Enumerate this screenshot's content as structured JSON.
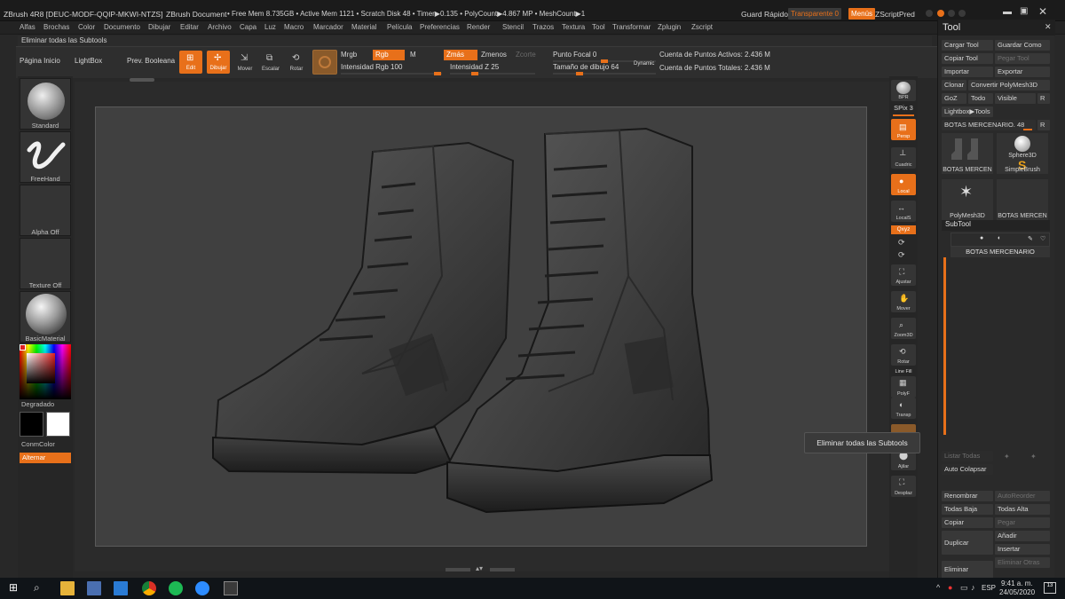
{
  "title": {
    "app": "ZBrush 4R8 [DEUC-MODF-QQIP-MKWI-NTZS]",
    "doc": "ZBrush Document",
    "stats": "• Free Mem 8.735GB • Active Mem 1121 • Scratch Disk 48 • Timer▶0.135 • PolyCount▶4.867 MP • MeshCount▶1",
    "quicksave": "Guard Rápido",
    "transparent": "Transparente 0",
    "menus": "Menús",
    "zscript": "ZScriptPred"
  },
  "menubar": [
    "Alfas",
    "Brochas",
    "Color",
    "Documento",
    "Dibujar",
    "Editar",
    "Archivo",
    "Capa",
    "Luz",
    "Macro",
    "Marcador",
    "Material",
    "Película",
    "Preferencias",
    "Render",
    "Stencil",
    "Trazos",
    "Textura",
    "Tool",
    "Transformar",
    "Zplugin",
    "Zscript"
  ],
  "notebar": "Eliminar todas las Subtools",
  "shelf": {
    "home": "Página Inicio",
    "lightbox": "LightBox",
    "preview": "Prev. Booleana",
    "edit": "Edit",
    "draw": "Dibujar",
    "move": "Mover",
    "scale": "Escalar",
    "rotate": "Rotar",
    "mrgb": "Mrgb",
    "rgb": "Rgb",
    "m": "M",
    "rgb_intensity": "Intensidad Rgb 100",
    "zadd": "Zmás",
    "zsub": "Zmenos",
    "zcut": "Zcorte",
    "z_intensity": "Intensidad Z 25",
    "focal": "Punto Focal 0",
    "draw_size": "Tamaño de dibujo 64",
    "dynamic": "Dynamic",
    "active_points": "Cuenta de Puntos Activos: 2.436 M",
    "total_points": "Cuenta de Puntos Totales: 2.436 M"
  },
  "leftshelf": {
    "standard": "Standard",
    "freehand": "FreeHand",
    "alpha": "Alpha Off",
    "texture": "Texture Off",
    "material": "BasicMaterial",
    "gradient": "Degradado",
    "switch": "ConmColor",
    "alternate": "Alternar"
  },
  "rshelf": {
    "bpr": "BPR",
    "spix": "SPix 3",
    "persp": "Persp",
    "floor": "Cuadric",
    "local": "Local",
    "local_sym": "LocalS",
    "xyz": "Qxyz",
    "frame": "Ajustar",
    "move": "Mover",
    "zoom": "Zoom3D",
    "rotate": "Rotar",
    "linefill": "Line Fill",
    "polyf": "PolyF",
    "transp": "Transp",
    "dynamic": "Ajilar",
    "solo": "Desplaz"
  },
  "tooltip": "Eliminar todas las Subtools",
  "tool": {
    "header": "Tool",
    "load": "Cargar Tool",
    "save_as": "Guardar Como",
    "copy_tool": "Copiar Tool",
    "paste_tool": "Pegar Tool",
    "import": "Importar",
    "export": "Exportar",
    "clone": "Clonar",
    "convert": "Convertir PolyMesh3D",
    "goz": "GoZ",
    "all": "Todo",
    "visible": "Visible",
    "r": "R",
    "lightbox_tools": "Lightbox▶Tools",
    "current": "BOTAS MERCENARIO. 48",
    "thumbs": [
      "BOTAS MERCEN",
      "Sphere3D",
      "SimpleBrush",
      "PolyMesh3D",
      "BOTAS MERCEN"
    ],
    "subtool": "SubTool",
    "subtool_item": "BOTAS MERCENARIO",
    "list_all": "Listar Todas",
    "auto_collapse": "Auto Colapsar",
    "rename": "Renombrar",
    "autoreorder": "AutoReorder",
    "all_low": "Todas Baja",
    "all_high": "Todas Alta",
    "copy": "Copiar",
    "paste": "Pegar",
    "duplicate": "Duplicar",
    "append": "Añadir",
    "insert": "Insertar",
    "delete": "Eliminar",
    "delete_other": "Eliminar Otras"
  },
  "taskbar": {
    "lang": "ESP",
    "time": "9:41 a. m.",
    "date": "24/05/2020",
    "notif": "13"
  }
}
